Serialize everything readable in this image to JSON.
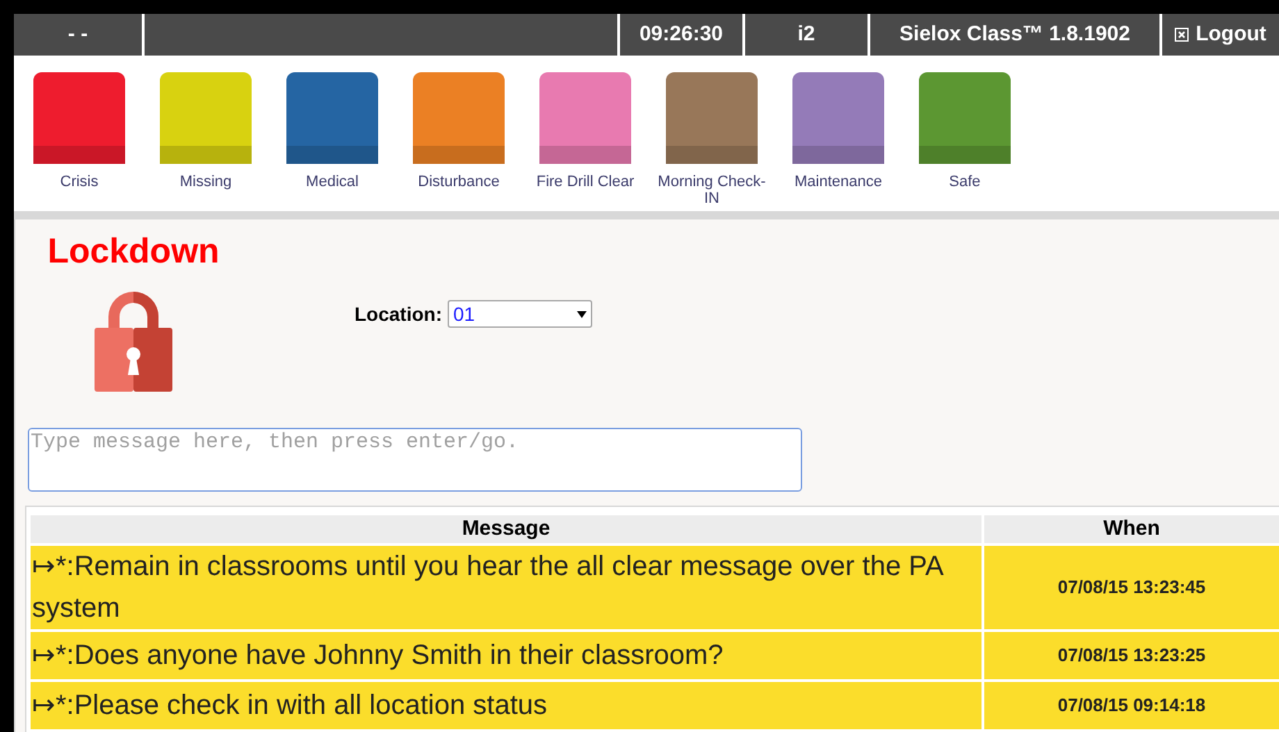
{
  "top_bar": {
    "status": "- -",
    "time": "09:26:30",
    "user": "i2",
    "product": "Sielox Class™ 1.8.1902",
    "logout": "Logout"
  },
  "alerts": [
    {
      "label": "Crisis",
      "color": "#ee1c2e"
    },
    {
      "label": "Missing",
      "color": "#d8d210"
    },
    {
      "label": "Medical",
      "color": "#2565a3"
    },
    {
      "label": "Disturbance",
      "color": "#eb8024"
    },
    {
      "label": "Fire Drill Clear",
      "color": "#e87ab0"
    },
    {
      "label": "Morning Check-IN",
      "color": "#987759"
    },
    {
      "label": "Maintenance",
      "color": "#947bb8"
    },
    {
      "label": "Safe",
      "color": "#5c9732"
    }
  ],
  "status": {
    "title": "Lockdown",
    "location_label": "Location:",
    "location": "01"
  },
  "message_input": {
    "placeholder": "Type message here, then press enter/go."
  },
  "table": {
    "columns": [
      "Message",
      "When"
    ],
    "rows": [
      {
        "message": "↦*:Remain in classrooms until you hear the all clear message over the PA system",
        "when": "07/08/15 13:23:45"
      },
      {
        "message": "↦*:Does anyone have Johnny Smith in their classroom?",
        "when": "07/08/15 13:23:25"
      },
      {
        "message": "↦*:Please check in with all location status",
        "when": "07/08/15 09:14:18"
      }
    ]
  }
}
